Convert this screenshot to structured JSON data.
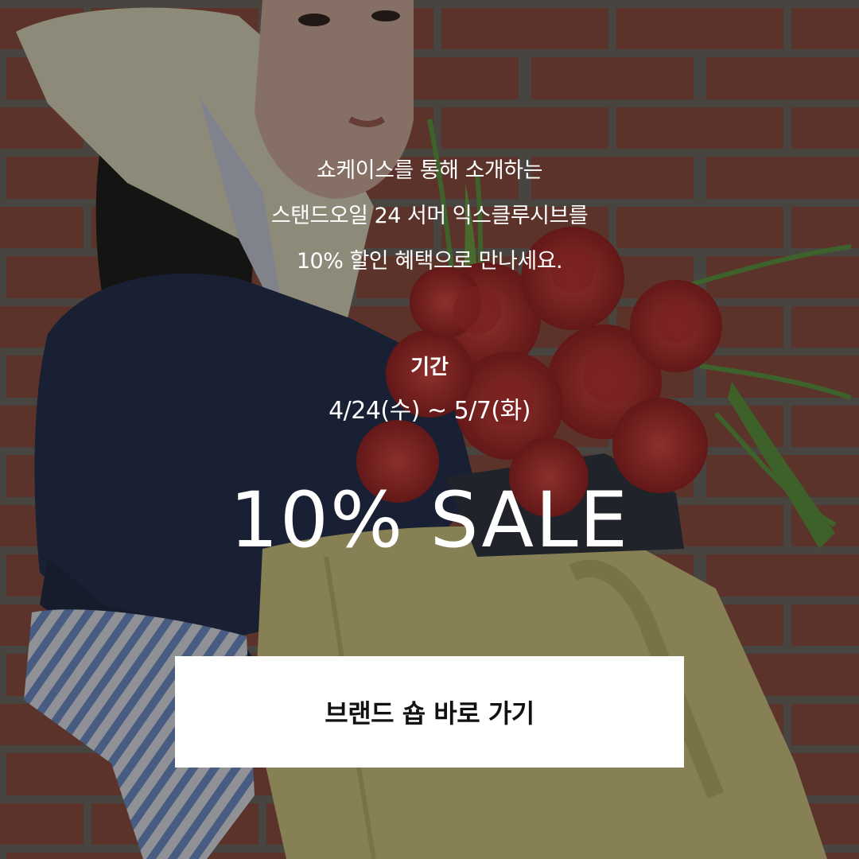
{
  "promo": {
    "intro_lines": [
      "쇼케이스를 통해 소개하는",
      "스탠드오일 24 서머 익스클루시브를",
      "10% 할인 혜택으로 만나세요."
    ],
    "period_label": "기간",
    "period_dates": "4/24(수) ~ 5/7(화)",
    "sale_headline": "10% SALE",
    "cta_label": "브랜드 숍 바로 가기"
  },
  "colors": {
    "text": "#ffffff",
    "button_bg": "#ffffff",
    "button_text": "#111111",
    "overlay": "rgba(20,18,18,0.42)"
  }
}
